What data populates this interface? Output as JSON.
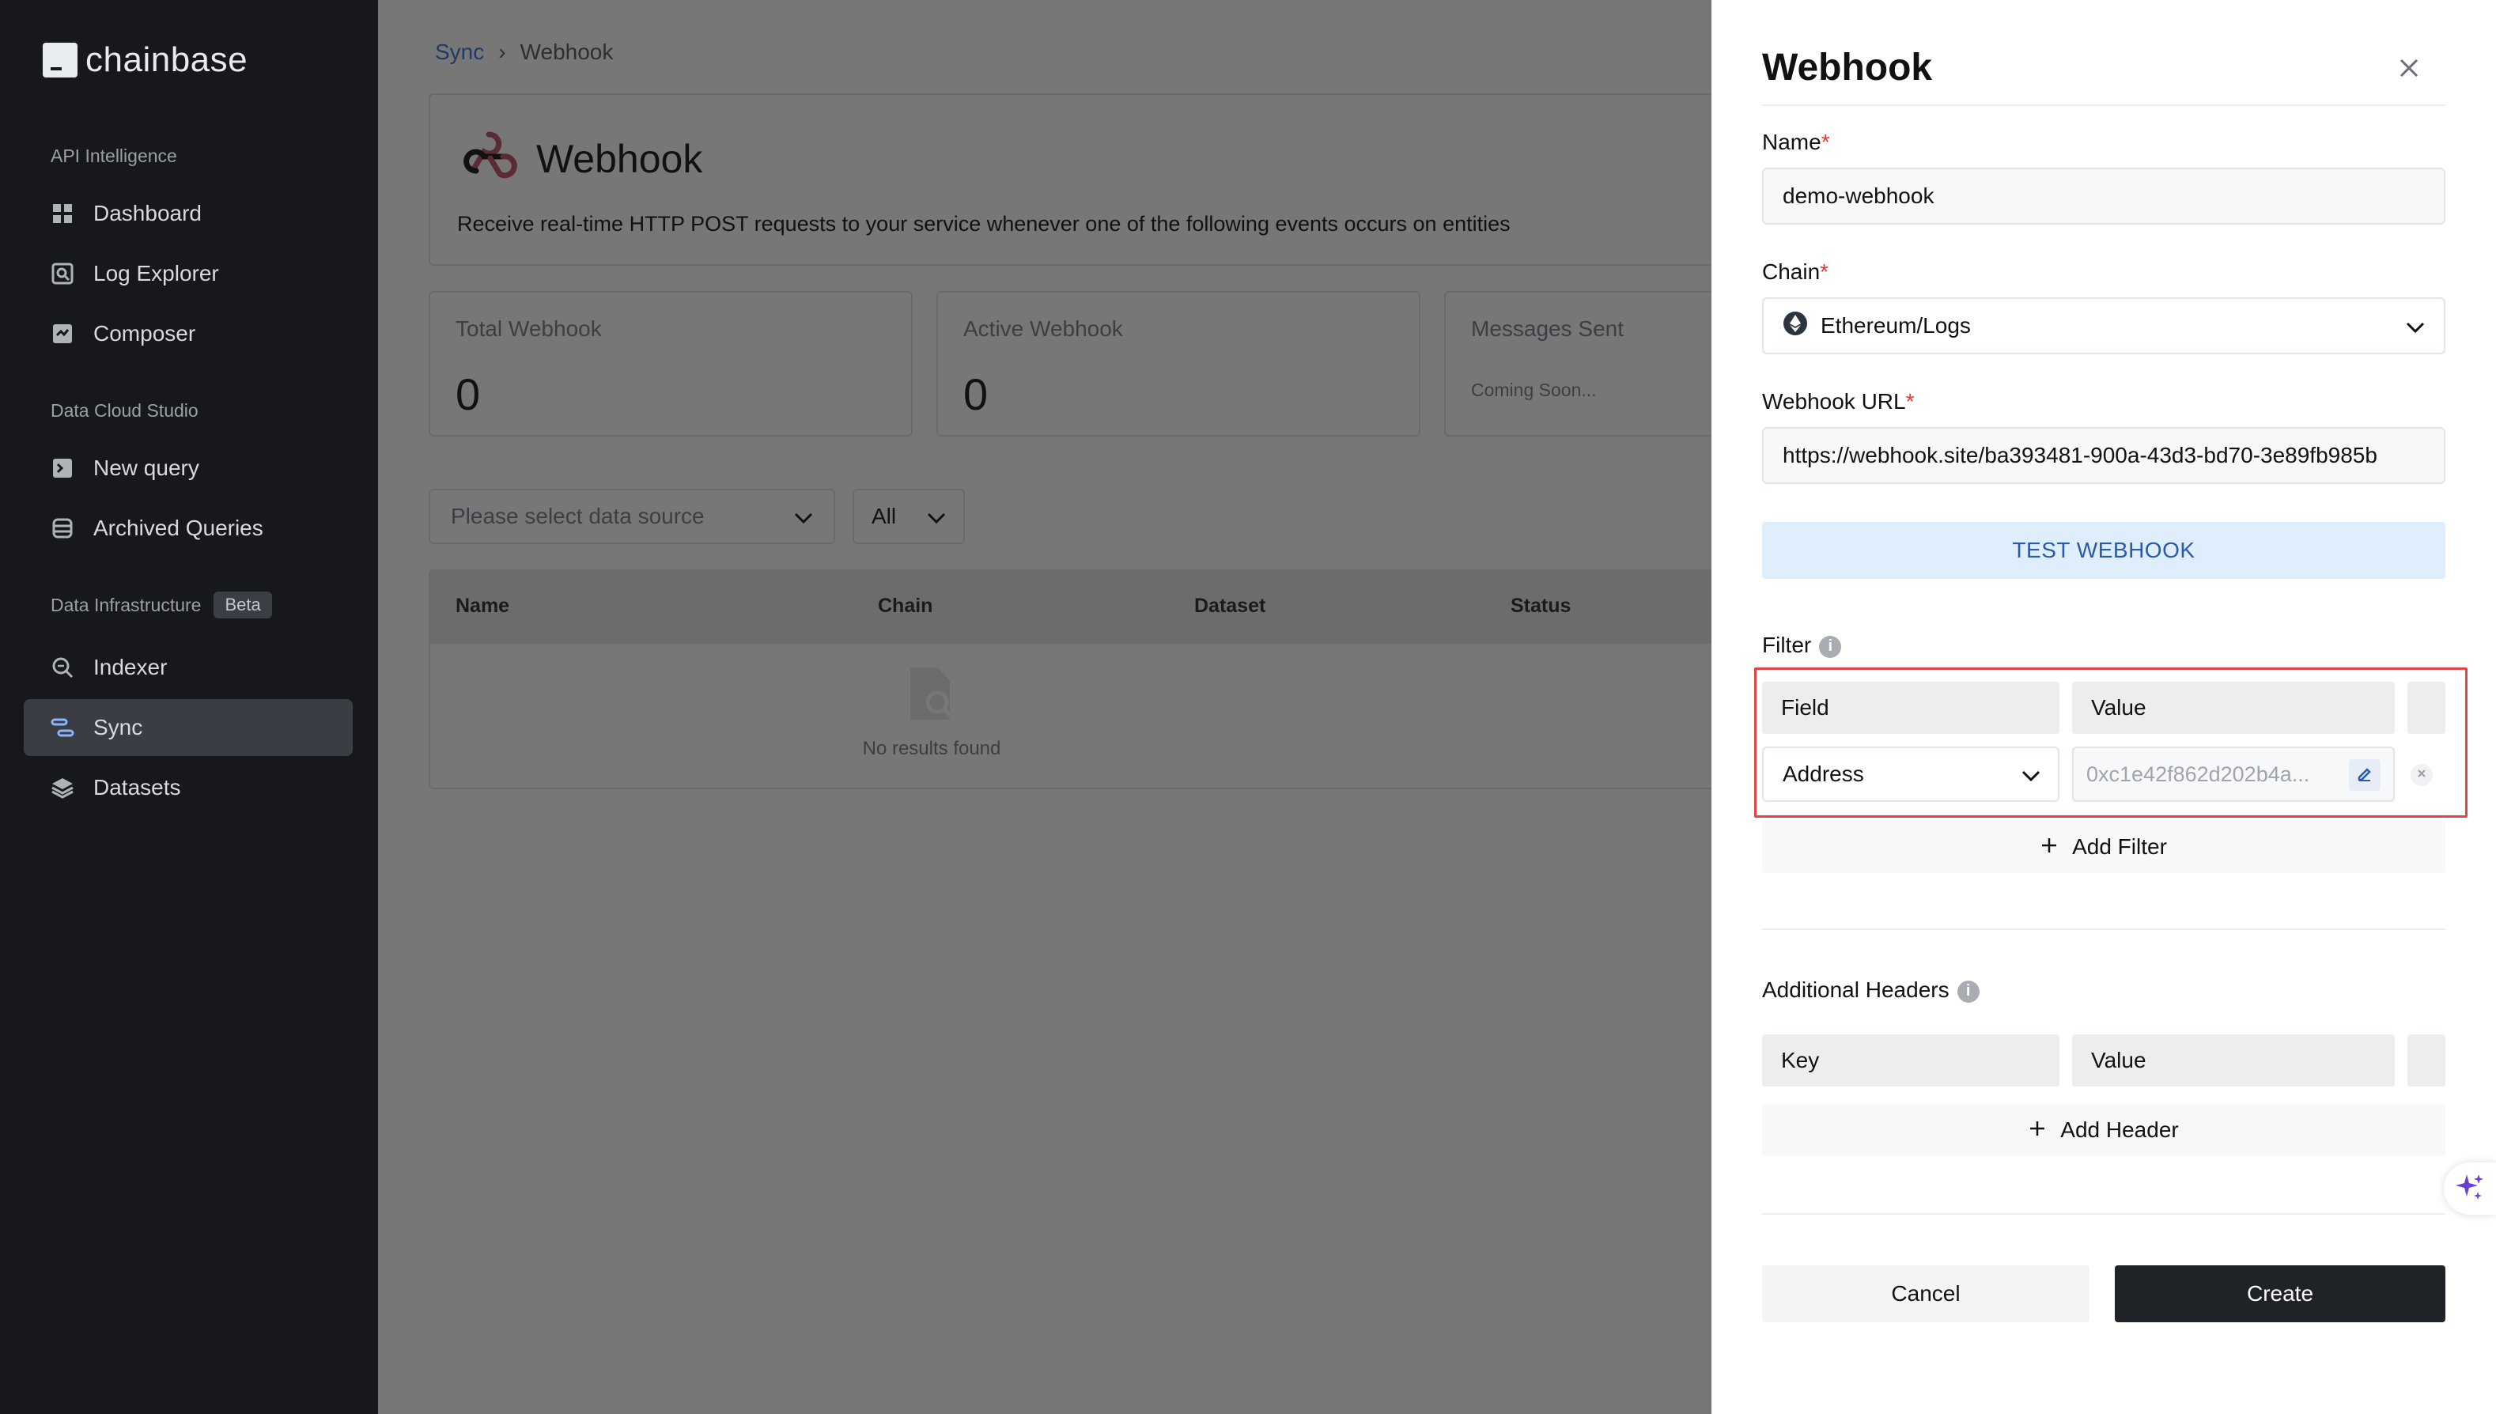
{
  "app": {
    "logo_text": "chainbase"
  },
  "sidebar": {
    "sections": [
      {
        "title": "API Intelligence",
        "items": [
          {
            "label": "Dashboard",
            "icon": "grid-icon"
          },
          {
            "label": "Log Explorer",
            "icon": "log-search-icon"
          },
          {
            "label": "Composer",
            "icon": "composer-icon"
          }
        ]
      },
      {
        "title": "Data Cloud Studio",
        "items": [
          {
            "label": "New query",
            "icon": "terminal-icon"
          },
          {
            "label": "Archived Queries",
            "icon": "archive-icon"
          }
        ]
      },
      {
        "title": "Data Infrastructure",
        "badge": "Beta",
        "items": [
          {
            "label": "Indexer",
            "icon": "indexer-icon"
          },
          {
            "label": "Sync",
            "icon": "sync-icon",
            "active": true
          },
          {
            "label": "Datasets",
            "icon": "layers-icon"
          }
        ]
      }
    ]
  },
  "breadcrumb": {
    "parent": "Sync",
    "separator": "›",
    "current": "Webhook"
  },
  "hero": {
    "title": "Webhook",
    "description": "Receive real-time HTTP POST requests to your service whenever one of the following events occurs on entities"
  },
  "stats": [
    {
      "label": "Total Webhook",
      "value": "0"
    },
    {
      "label": "Active Webhook",
      "value": "0"
    },
    {
      "label": "Messages Sent",
      "sub": "Coming Soon..."
    }
  ],
  "filters": {
    "data_source_placeholder": "Please select data source",
    "status_value": "All"
  },
  "table": {
    "columns": [
      "Name",
      "Chain",
      "Dataset",
      "Status"
    ],
    "empty_text": "No results found"
  },
  "drawer": {
    "title": "Webhook",
    "name_label": "Name",
    "name_value": "demo-webhook",
    "chain_label": "Chain",
    "chain_value": "Ethereum/Logs",
    "url_label": "Webhook URL",
    "url_value": "https://webhook.site/ba393481-900a-43d3-bd70-3e89fb985b",
    "required_mark": "*",
    "test_button": "TEST WEBHOOK",
    "filter_label": "Filter",
    "filter_head_field": "Field",
    "filter_head_value": "Value",
    "filter_row_field": "Address",
    "filter_row_value": "0xc1e42f862d202b4a...",
    "add_filter": "Add Filter",
    "headers_label": "Additional Headers",
    "headers_head_key": "Key",
    "headers_head_value": "Value",
    "add_header": "Add Header",
    "cancel": "Cancel",
    "create": "Create"
  },
  "colors": {
    "accent": "#2d5aa8",
    "highlight": "#e04545",
    "sidebar_bg": "#16181b",
    "primary_btn": "#1f2327"
  }
}
